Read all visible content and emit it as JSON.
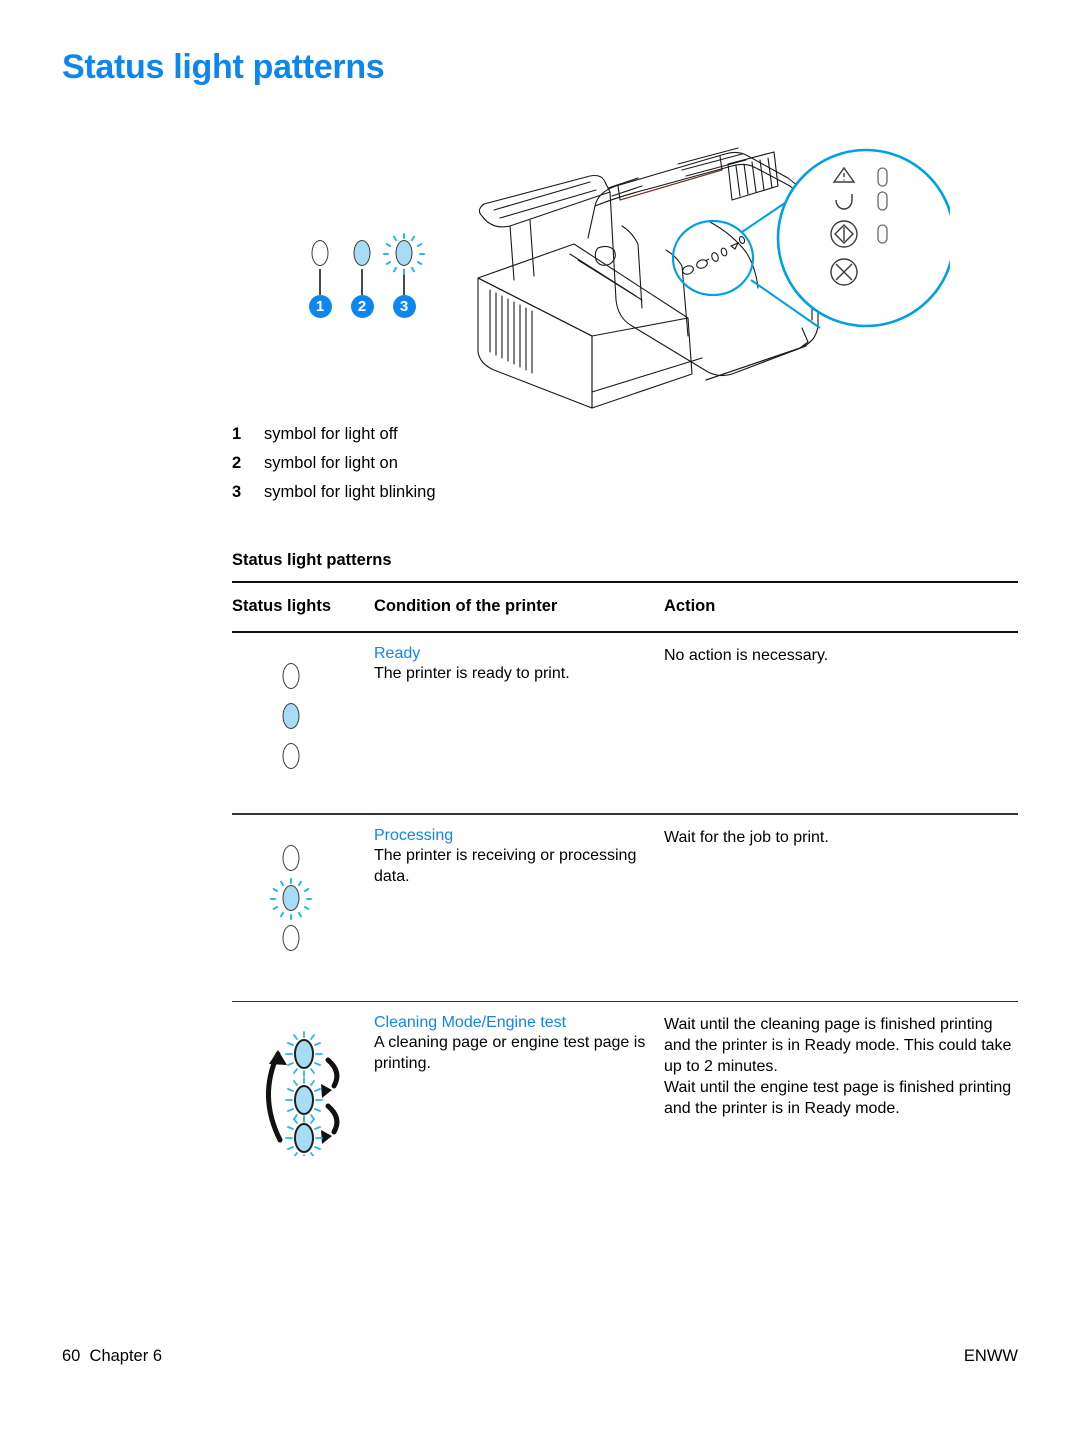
{
  "page": {
    "title": "Status light patterns",
    "accent_color": "#0e86ef",
    "lamp_on_color": "#a6dcf4",
    "lamp_outline_color": "#3a3a3a"
  },
  "figure": {
    "legend_symbols": [
      {
        "badge": "1",
        "state": "off"
      },
      {
        "badge": "2",
        "state": "on"
      },
      {
        "badge": "3",
        "state": "blinking"
      }
    ],
    "callout": {
      "attention_icon": "warning-triangle-icon",
      "ready_icon": "ready-circle-icon",
      "go_icon": "go-button-icon",
      "cancel_icon": "cancel-button-icon"
    }
  },
  "legend": [
    {
      "num": "1",
      "text": "symbol for light off"
    },
    {
      "num": "2",
      "text": "symbol for light on"
    },
    {
      "num": "3",
      "text": "symbol for light blinking"
    }
  ],
  "table": {
    "caption": "Status light patterns",
    "headers": {
      "lights": "Status lights",
      "condition": "Condition of the printer",
      "action": "Action"
    },
    "rows": [
      {
        "lights": [
          "off",
          "on",
          "off"
        ],
        "state_name": "Ready",
        "condition": "The printer is ready to print.",
        "actions": [
          "No action is necessary."
        ]
      },
      {
        "lights": [
          "off",
          "blinking",
          "off"
        ],
        "state_name": "Processing",
        "condition": "The printer is receiving or processing data.",
        "actions": [
          "Wait for the job to print."
        ]
      },
      {
        "lights": [
          "blinking",
          "blinking",
          "blinking"
        ],
        "cyclic": true,
        "state_name": "Cleaning Mode/Engine test",
        "condition": "A cleaning page or engine test page is printing.",
        "actions": [
          "Wait until the cleaning page is finished printing and the printer is in Ready mode. This could take up to 2 minutes.",
          "Wait until the engine test page is finished printing and the printer is in Ready mode."
        ]
      }
    ]
  },
  "footer": {
    "page_number": "60",
    "chapter": "Chapter 6",
    "locale": "ENWW"
  }
}
